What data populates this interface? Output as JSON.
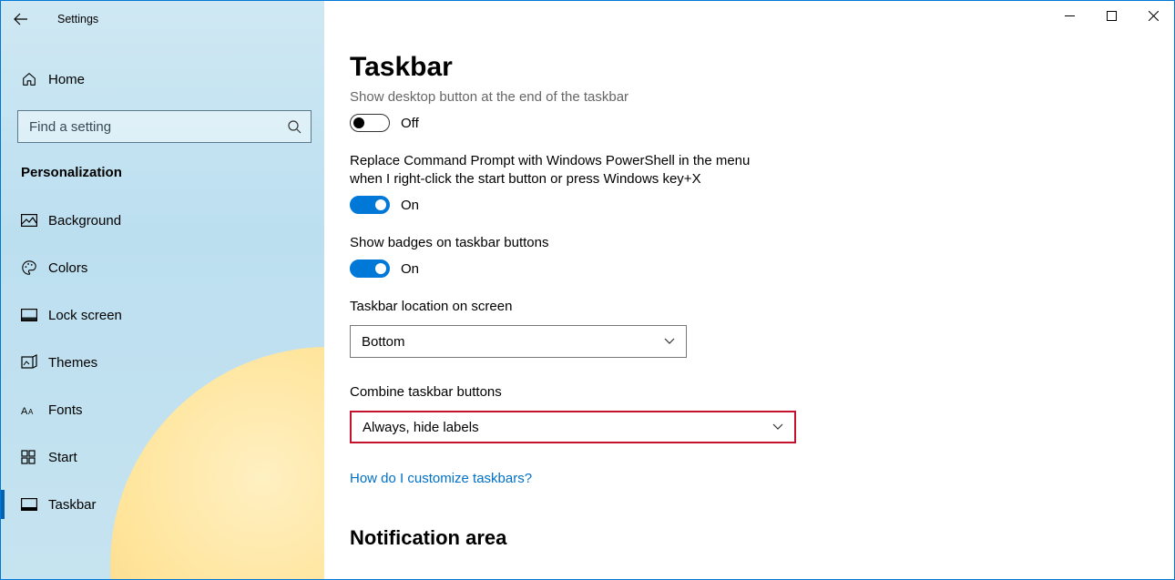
{
  "app": {
    "title": "Settings"
  },
  "sidebar": {
    "home_label": "Home",
    "search_placeholder": "Find a setting",
    "category": "Personalization",
    "items": [
      {
        "label": "Background"
      },
      {
        "label": "Colors"
      },
      {
        "label": "Lock screen"
      },
      {
        "label": "Themes"
      },
      {
        "label": "Fonts"
      },
      {
        "label": "Start"
      },
      {
        "label": "Taskbar"
      }
    ]
  },
  "main": {
    "page_title": "Taskbar",
    "show_desktop": {
      "desc": "Show desktop button at the end of the taskbar",
      "state": "Off"
    },
    "powershell": {
      "desc": "Replace Command Prompt with Windows PowerShell in the menu when I right-click the start button or press Windows key+X",
      "state": "On"
    },
    "badges": {
      "desc": "Show badges on taskbar buttons",
      "state": "On"
    },
    "location": {
      "label": "Taskbar location on screen",
      "value": "Bottom"
    },
    "combine": {
      "label": "Combine taskbar buttons",
      "value": "Always, hide labels"
    },
    "help_link": "How do I customize taskbars?",
    "notification_header": "Notification area"
  }
}
